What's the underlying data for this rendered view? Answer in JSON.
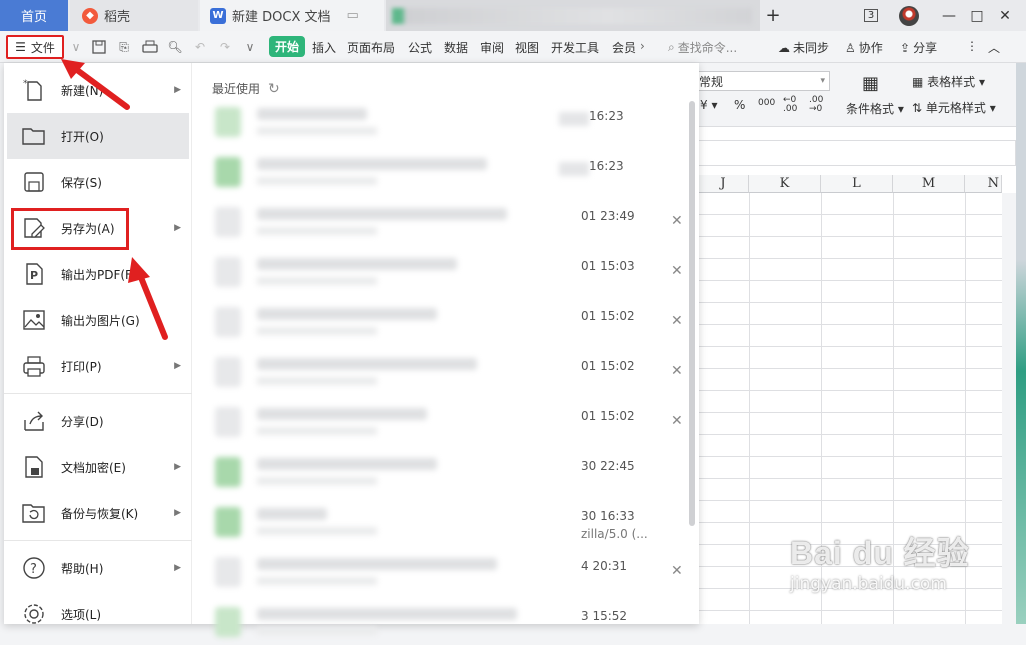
{
  "tabs": [
    {
      "label": "首页"
    },
    {
      "label": "稻壳"
    },
    {
      "label": "新建 DOCX 文档"
    }
  ],
  "window": {
    "badge": "3",
    "minimize": "—",
    "maximize": "□",
    "close": "✕",
    "new_tab": "+"
  },
  "toolbar": {
    "file_label": "文件",
    "start_label": "开始",
    "menus": [
      "插入",
      "页面布局",
      "公式",
      "数据",
      "审阅",
      "视图",
      "开发工具",
      "会员"
    ],
    "search_placeholder": "查找命令...",
    "actions": [
      "未同步",
      "协作",
      "分享"
    ]
  },
  "ribbon": {
    "format_value": "常规",
    "cond_format": "条件格式",
    "table_style": "表格样式",
    "cell_style": "单元格样式"
  },
  "columns": [
    "J",
    "K",
    "L",
    "M",
    "N"
  ],
  "file_menu": {
    "items": [
      {
        "label": "新建(N)",
        "icon": "new-file-icon"
      },
      {
        "label": "打开(O)",
        "icon": "folder-open-icon"
      },
      {
        "label": "保存(S)",
        "icon": "save-icon"
      },
      {
        "label": "另存为(A)",
        "icon": "save-as-icon"
      },
      {
        "label": "输出为PDF(F)",
        "icon": "pdf-icon"
      },
      {
        "label": "输出为图片(G)",
        "icon": "image-icon"
      },
      {
        "label": "打印(P)",
        "icon": "print-icon"
      },
      {
        "label": "分享(D)",
        "icon": "share-icon"
      },
      {
        "label": "文档加密(E)",
        "icon": "lock-doc-icon"
      },
      {
        "label": "备份与恢复(K)",
        "icon": "backup-icon"
      },
      {
        "label": "帮助(H)",
        "icon": "help-icon"
      },
      {
        "label": "选项(L)",
        "icon": "gear-icon"
      }
    ]
  },
  "recent": {
    "title": "最近使用",
    "times": [
      "16:23",
      "16:23",
      "01 23:49",
      "01 15:03",
      "01 15:02",
      "01 15:02",
      "01 15:02",
      "30 22:45",
      "30 16:33",
      "4 20:31",
      "3 15:52"
    ],
    "extra": "zilla/5.0 (..."
  },
  "watermark": {
    "brand": "Bai du 经验",
    "url": "jingyan.baidu.com"
  }
}
